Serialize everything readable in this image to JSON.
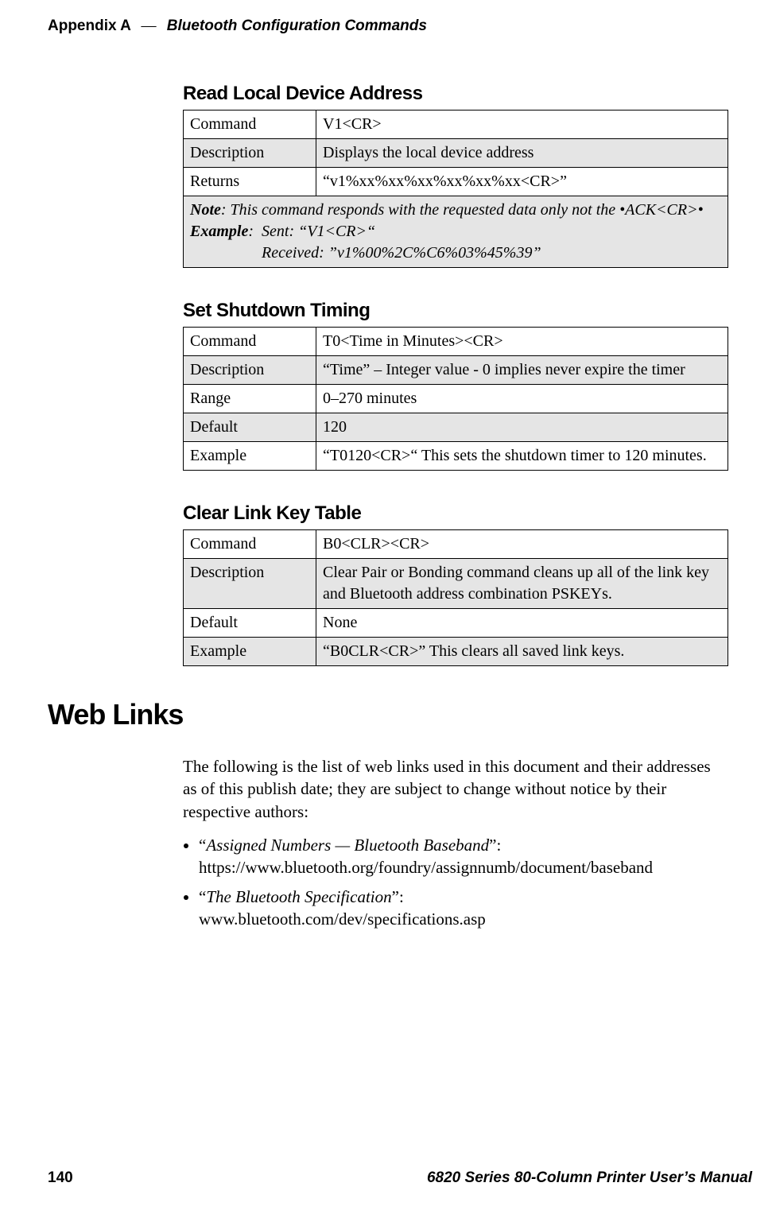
{
  "running_head": {
    "appendix": "Appendix A",
    "title": "Bluetooth Configuration Commands"
  },
  "sections": {
    "read_local": {
      "title": "Read Local Device Address",
      "rows": {
        "command_label": "Command",
        "command_value": "V1<CR>",
        "description_label": "Description",
        "description_value": "Displays the local device address",
        "returns_label": "Returns",
        "returns_value": "“v1%xx%xx%xx%xx%xx%xx<CR>”",
        "note_lead": "Note",
        "note_text": ": This command responds with the requested data only not the •ACK<CR>•",
        "example_lead": "Example",
        "example_sent": "Sent: “V1<CR>“",
        "example_received": "Received: ”v1%00%2C%C6%03%45%39”"
      }
    },
    "set_shutdown": {
      "title": "Set Shutdown Timing",
      "rows": {
        "command_label": "Command",
        "command_value": "T0<Time in Minutes><CR>",
        "description_label": "Description",
        "description_value": "“Time” – Integer value - 0 implies never expire the timer",
        "range_label": "Range",
        "range_value": "0–270 minutes",
        "default_label": "Default",
        "default_value": "120",
        "example_label": "Example",
        "example_value": "“T0120<CR>“ This sets the shutdown timer to 120 minutes."
      }
    },
    "clear_link": {
      "title": "Clear Link Key Table",
      "rows": {
        "command_label": "Command",
        "command_value": "B0<CLR><CR>",
        "description_label": "Description",
        "description_value": "Clear Pair or Bonding command cleans up all of the link key and Bluetooth address combination PSKEYs.",
        "default_label": "Default",
        "default_value": "None",
        "example_label": "Example",
        "example_value": "“B0CLR<CR>” This clears all saved link keys."
      }
    }
  },
  "web_links": {
    "heading": "Web Links",
    "intro": "The following is the list of web links used in this document and their addresses as of this publish date; they are subject to change without notice by their respective authors:",
    "items": [
      {
        "title": "Assigned Numbers — Bluetooth Baseband",
        "url": "https://www.bluetooth.org/foundry/assignnumb/document/baseband"
      },
      {
        "title": "The Bluetooth Specification",
        "url": "www.bluetooth.com/dev/specifications.asp"
      }
    ]
  },
  "footer": {
    "page": "140",
    "manual": "6820 Series 80-Column Printer User’s Manual"
  }
}
